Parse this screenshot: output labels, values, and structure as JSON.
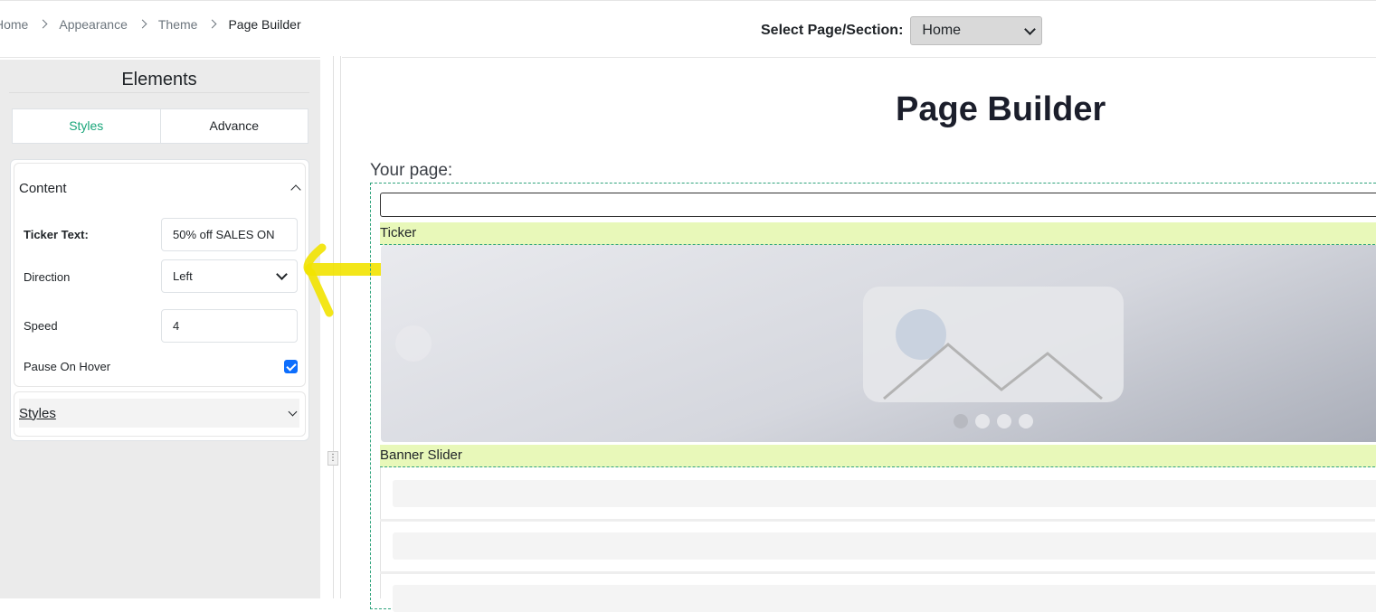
{
  "breadcrumb": {
    "items": [
      "Home",
      "Appearance",
      "Theme",
      "Page Builder"
    ]
  },
  "header": {
    "select_label": "Select Page/Section:",
    "select_value": "Home"
  },
  "sidebar": {
    "title": "Elements",
    "tabs": [
      "Styles",
      "Advance"
    ],
    "active_tab": "Styles",
    "content_section": {
      "title": "Content",
      "fields": {
        "ticker_text_label": "Ticker Text:",
        "ticker_text_value": "50% off SALES ON",
        "direction_label": "Direction",
        "direction_value": "Left",
        "speed_label": "Speed",
        "speed_value": "4",
        "pause_label": "Pause On Hover",
        "pause_checked": true
      }
    },
    "styles_section": {
      "title": "Styles"
    }
  },
  "main": {
    "title": "Page Builder",
    "your_page_label": "Your page:",
    "sections": [
      "Ticker",
      "Banner Slider"
    ]
  },
  "colors": {
    "accent": "#1aa67a",
    "section_label_bg": "#e8f8b9",
    "arrow_annotation": "#f2e300",
    "checkbox": "#0d6efd"
  }
}
